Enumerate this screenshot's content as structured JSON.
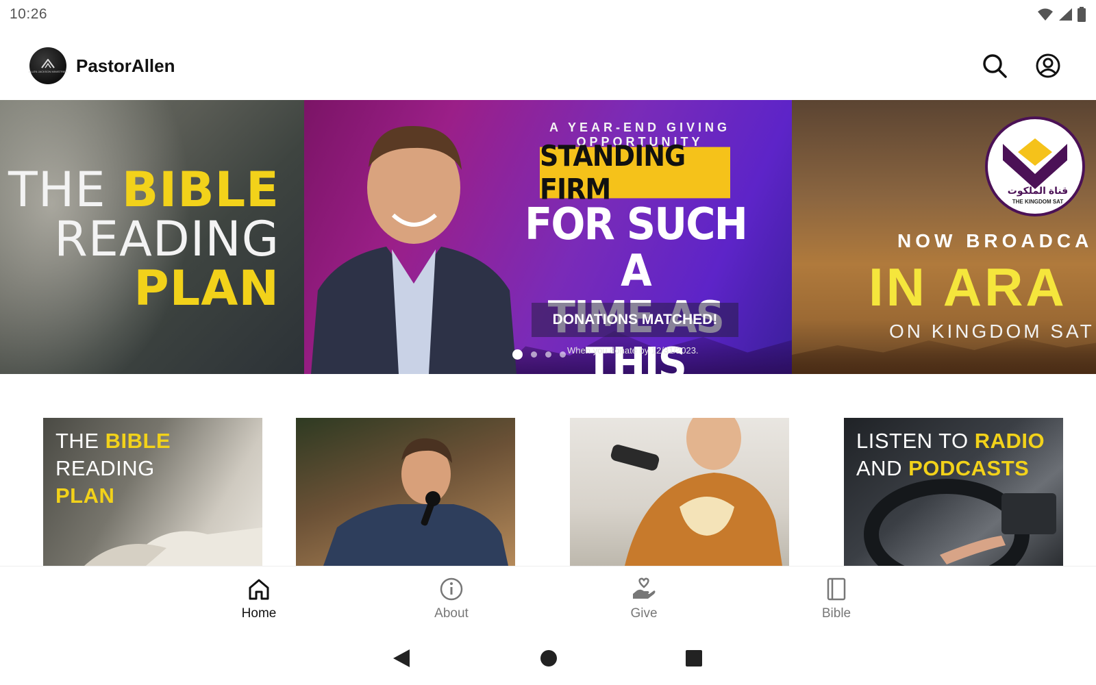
{
  "status_bar": {
    "time": "10:26",
    "icons": [
      "wifi-icon",
      "signal-icon",
      "battery-icon"
    ]
  },
  "app_bar": {
    "title": "PastorAllen",
    "logo_text": "ALLEN JACKSON MINISTRIES",
    "actions": [
      "search-icon",
      "account-circle-icon"
    ]
  },
  "carousel": {
    "slides": [
      {
        "line1_white": "THE ",
        "line1_yellow": "BIBLE",
        "line2": "READING",
        "line3": "PLAN"
      },
      {
        "eyebrow": "A YEAR-END GIVING OPPORTUNITY",
        "badge": "STANDING FIRM",
        "headline_1": "FOR SUCH A",
        "headline_2": "TIME AS THIS",
        "cta": "DONATIONS MATCHED!",
        "fine_print": "When you donate by 12/31/2023."
      },
      {
        "logo_arabic": "قناة الملكوت",
        "logo_latin": "THE KINGDOM SAT",
        "line1": "NOW BROADCA",
        "line2": "IN ARA",
        "line3": "ON KINGDOM SAT"
      }
    ],
    "page_count": 4,
    "active_index": 0
  },
  "tiles": [
    {
      "line1_white": "THE ",
      "line1_yellow": "BIBLE",
      "line2": "READING",
      "line3": "PLAN"
    },
    {
      "caption": ""
    },
    {
      "caption": ""
    },
    {
      "line1_white": "LISTEN TO ",
      "line1_yellow": "RADIO",
      "line2_white": "AND ",
      "line2_yellow": "PODCASTS"
    }
  ],
  "bottom_nav": {
    "items": [
      {
        "label": "Home",
        "icon": "home-icon",
        "active": true
      },
      {
        "label": "About",
        "icon": "info-icon",
        "active": false
      },
      {
        "label": "Give",
        "icon": "give-hand-heart-icon",
        "active": false
      },
      {
        "label": "Bible",
        "icon": "book-icon",
        "active": false
      }
    ]
  },
  "system_nav": [
    "back-icon",
    "home-circle-icon",
    "recents-square-icon"
  ],
  "colors": {
    "accent_yellow": "#f2d21a",
    "badge_yellow": "#f5c21a",
    "purple": "#7a2bb8"
  }
}
